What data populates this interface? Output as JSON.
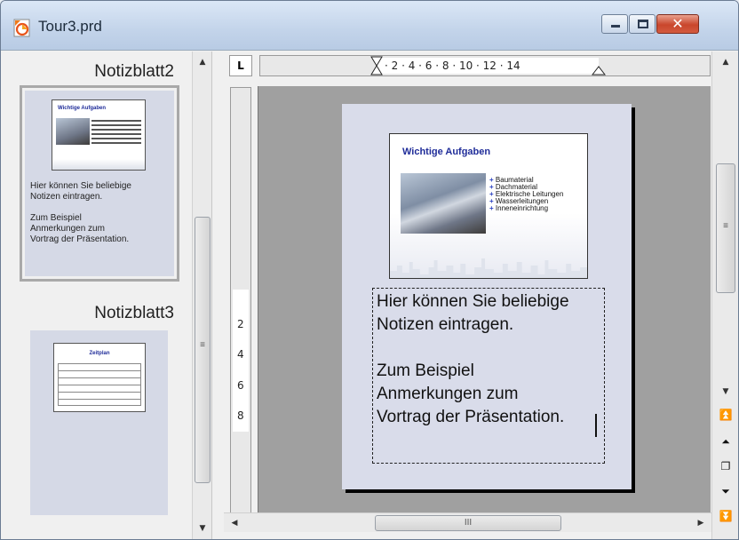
{
  "window": {
    "title": "Tour3.prd",
    "controls": {
      "minimize": "",
      "maximize": "",
      "close": "✕"
    }
  },
  "slides_pane": {
    "items": [
      {
        "label": "Notizblatt2",
        "notes": "Hier können Sie beliebige\nNotizen eintragen.\n\nZum Beispiel\nAnmerkungen zum\nVortrag der Präsentation.",
        "selected": true
      },
      {
        "label": "Notizblatt3",
        "notes": "",
        "selected": false
      }
    ]
  },
  "ruler": {
    "corner": "L",
    "horizontal": "· 2 · 4 · 6 · 8 · 10 · 12 · 14",
    "vertical": [
      "2",
      "4",
      "6",
      "8"
    ]
  },
  "page": {
    "slide_title": "Wichtige Aufgaben",
    "bullets": [
      "Baumaterial",
      "Dachmaterial",
      "Elektrische Leitungen",
      "Wasserleitungen",
      "Inneneinrichtung"
    ],
    "notes_lines": [
      "Hier können Sie beliebige",
      "Notizen eintragen.",
      "",
      "Zum Beispiel",
      "Anmerkungen zum",
      "Vortrag der Präsentation."
    ]
  },
  "scrollbars": {
    "hscroll_grip": "III",
    "vscroll_grip": "≡"
  },
  "icons": {
    "app": "app-icon",
    "nav": [
      "first-page-icon",
      "previous-page-icon",
      "navigator-icon",
      "next-page-icon",
      "last-page-icon"
    ]
  },
  "colors": {
    "slide_title": "#1f2c99",
    "bullet": "#2840c0",
    "page_bg": "#d9dcea"
  }
}
